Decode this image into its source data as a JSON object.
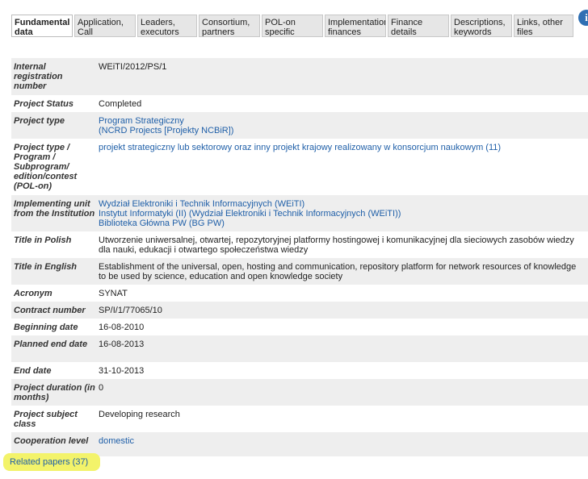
{
  "tabs": [
    {
      "label": "Fundamental data",
      "active": true
    },
    {
      "label": "Application, Call"
    },
    {
      "label": "Leaders, executors"
    },
    {
      "label": "Consortium, partners"
    },
    {
      "label": "POL-on specific"
    },
    {
      "label": "Implementation, finances"
    },
    {
      "label": "Finance details"
    },
    {
      "label": "Descriptions, keywords"
    },
    {
      "label": "Links, other files"
    }
  ],
  "fields": {
    "reg_no": {
      "label": "Internal registration number",
      "value": "WEiTI/2012/PS/1"
    },
    "status": {
      "label": "Project Status",
      "value": "Completed"
    },
    "type": {
      "label": "Project type",
      "link1": "Program Strategiczny",
      "link2": "(NCRD Projects [Projekty NCBiR])"
    },
    "subtype": {
      "label": "Project type / Program / Subprogram/ edition/contest (POL-on)",
      "link": "projekt strategiczny lub sektorowy oraz inny projekt krajowy realizowany w konsorcjum naukowym (11)"
    },
    "unit": {
      "label": "Implementing unit from the Institution",
      "link1": "Wydział Elektroniki i Technik Informacyjnych (WEiTI)",
      "link2": "Instytut Informatyki (II) (Wydział Elektroniki i Technik Informacyjnych (WEiTI))",
      "link3": "Biblioteka Główna PW (BG PW)"
    },
    "title_pl": {
      "label": "Title in Polish",
      "value": "Utworzenie uniwersalnej, otwartej, repozytoryjnej platformy hostingowej i komunikacyjnej dla sieciowych zasobów wiedzy dla nauki, edukacji i otwartego społeczeństwa wiedzy"
    },
    "title_en": {
      "label": "Title in English",
      "value": "Establishment of the universal, open, hosting and communication, repository platform for network resources of knowledge to be used by science, education and open knowledge society"
    },
    "acronym": {
      "label": "Acronym",
      "value": "SYNAT"
    },
    "contract": {
      "label": "Contract number",
      "value": "SP/I/1/77065/10"
    },
    "begin": {
      "label": "Beginning date",
      "value": "16-08-2010"
    },
    "planned_end": {
      "label": "Planned end date",
      "value": "16-08-2013"
    },
    "end": {
      "label": "End date",
      "value": "31-10-2013"
    },
    "duration": {
      "label": "Project duration (in months)",
      "value": "0"
    },
    "subject_class": {
      "label": "Project subject class",
      "value": "Developing research"
    },
    "cooperation": {
      "label": "Cooperation level",
      "link": "domestic"
    }
  },
  "related_papers": "Related papers (37)",
  "icons": {
    "info": "info-icon"
  }
}
